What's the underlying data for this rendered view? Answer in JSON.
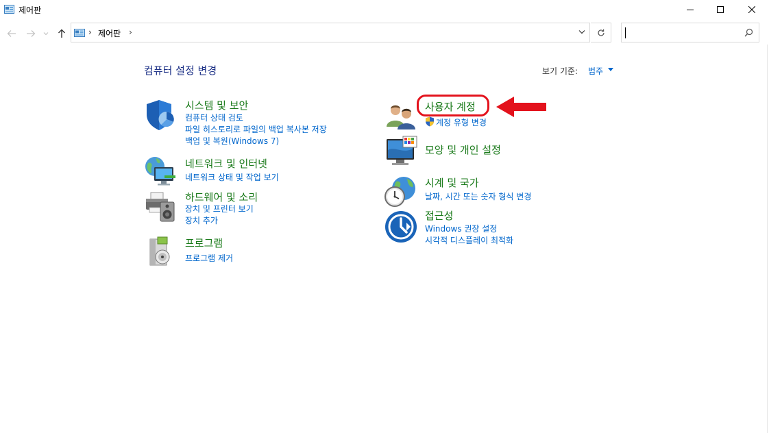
{
  "window": {
    "title": "제어판"
  },
  "address": {
    "crumb": "제어판",
    "search_placeholder": ""
  },
  "content": {
    "heading": "컴퓨터 설정 변경",
    "view_by_label": "보기 기준:",
    "view_by_value": "범주"
  },
  "categories_left": [
    {
      "title": "시스템 및 보안",
      "links": [
        "컴퓨터 상태 검토",
        "파일 히스토리로 파일의 백업 복사본 저장",
        "백업 및 복원(Windows 7)"
      ],
      "icon": "shield-icon"
    },
    {
      "title": "네트워크 및 인터넷",
      "links": [
        "네트워크 상태 및 작업 보기"
      ],
      "icon": "network-globe-icon"
    },
    {
      "title": "하드웨어 및 소리",
      "links": [
        "장치 및 프린터 보기",
        "장치 추가"
      ],
      "icon": "printer-speaker-icon"
    },
    {
      "title": "프로그램",
      "links": [
        "프로그램 제거"
      ],
      "icon": "program-box-icon"
    }
  ],
  "categories_right": [
    {
      "title": "사용자 계정",
      "links": [
        "계정 유형 변경"
      ],
      "icon": "user-accounts-icon"
    },
    {
      "title": "모양 및 개인 설정",
      "links": [],
      "icon": "monitor-palette-icon"
    },
    {
      "title": "시계 및 국가",
      "links": [
        "날짜, 시간 또는 숫자 형식 변경"
      ],
      "icon": "clock-globe-icon"
    },
    {
      "title": "접근성",
      "links": [
        "Windows 권장 설정",
        "시각적 디스플레이 최적화"
      ],
      "icon": "accessibility-icon"
    }
  ],
  "colors": {
    "title_green": "#1a7a1a",
    "link_blue": "#0066cc",
    "heading_blue": "#1e3287",
    "annotation_red": "#e3121c"
  }
}
